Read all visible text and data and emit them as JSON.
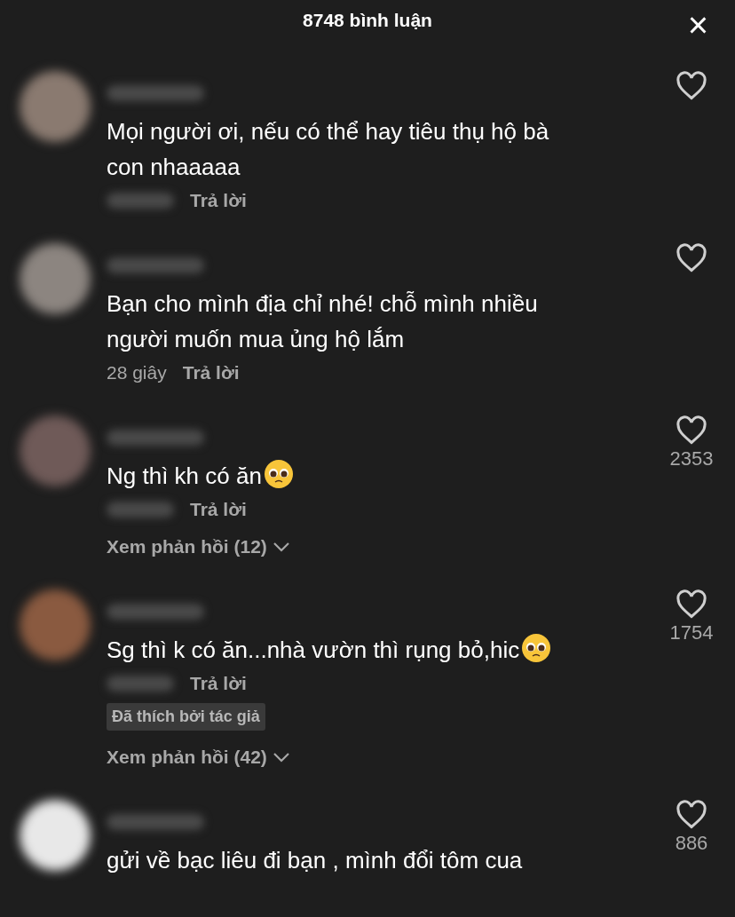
{
  "header": {
    "title": "8748 bình luận",
    "close": "×"
  },
  "comments": [
    {
      "text": "Mọi người ơi, nếu có thể hay tiêu thụ hộ bà con nhaaaaa",
      "emoji": false,
      "reply": "Trả lời"
    },
    {
      "text": "Bạn cho mình địa chỉ nhé! chỗ mình nhiều người muốn mua ủng hộ lắm",
      "emoji": false,
      "time": "28 giây",
      "reply": "Trả lời"
    },
    {
      "text": "Ng thì kh có ăn",
      "emoji": true,
      "reply": "Trả lời",
      "likes": "2353",
      "more": "Xem phản hồi (12)"
    },
    {
      "text": "Sg thì k có ăn...nhà vườn thì rụng bỏ,hic",
      "emoji": true,
      "reply": "Trả lời",
      "likes": "1754",
      "badge": "Đã thích bởi tác giả",
      "more": "Xem phản hồi (42)"
    },
    {
      "text": "gửi về bạc liêu đi bạn , mình đổi tôm cua",
      "emoji": false,
      "likes": "886"
    }
  ]
}
